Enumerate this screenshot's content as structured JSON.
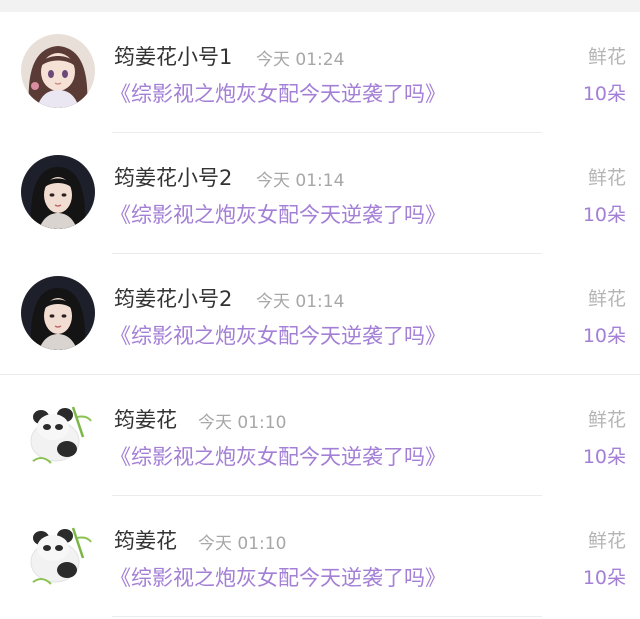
{
  "gifts": [
    {
      "avatar": "anime-girl-avatar",
      "user": "筠姜花小号1",
      "time": "今天 01:24",
      "book_title": "《综影视之炮灰女配今天逆袭了吗》",
      "gift_type": "鲜花",
      "gift_count": "10朵"
    },
    {
      "avatar": "actress-avatar",
      "user": "筠姜花小号2",
      "time": "今天 01:14",
      "book_title": "《综影视之炮灰女配今天逆袭了吗》",
      "gift_type": "鲜花",
      "gift_count": "10朵"
    },
    {
      "avatar": "actress-avatar",
      "user": "筠姜花小号2",
      "time": "今天 01:14",
      "book_title": "《综影视之炮灰女配今天逆袭了吗》",
      "gift_type": "鲜花",
      "gift_count": "10朵"
    },
    {
      "avatar": "panda-avatar",
      "user": "筠姜花",
      "time": "今天 01:10",
      "book_title": "《综影视之炮灰女配今天逆袭了吗》",
      "gift_type": "鲜花",
      "gift_count": "10朵"
    },
    {
      "avatar": "panda-avatar",
      "user": "筠姜花",
      "time": "今天 01:10",
      "book_title": "《综影视之炮灰女配今天逆袭了吗》",
      "gift_type": "鲜花",
      "gift_count": "10朵"
    }
  ],
  "colors": {
    "accent": "#a37fd6",
    "name": "#333333",
    "muted": "#a7a7a7"
  }
}
